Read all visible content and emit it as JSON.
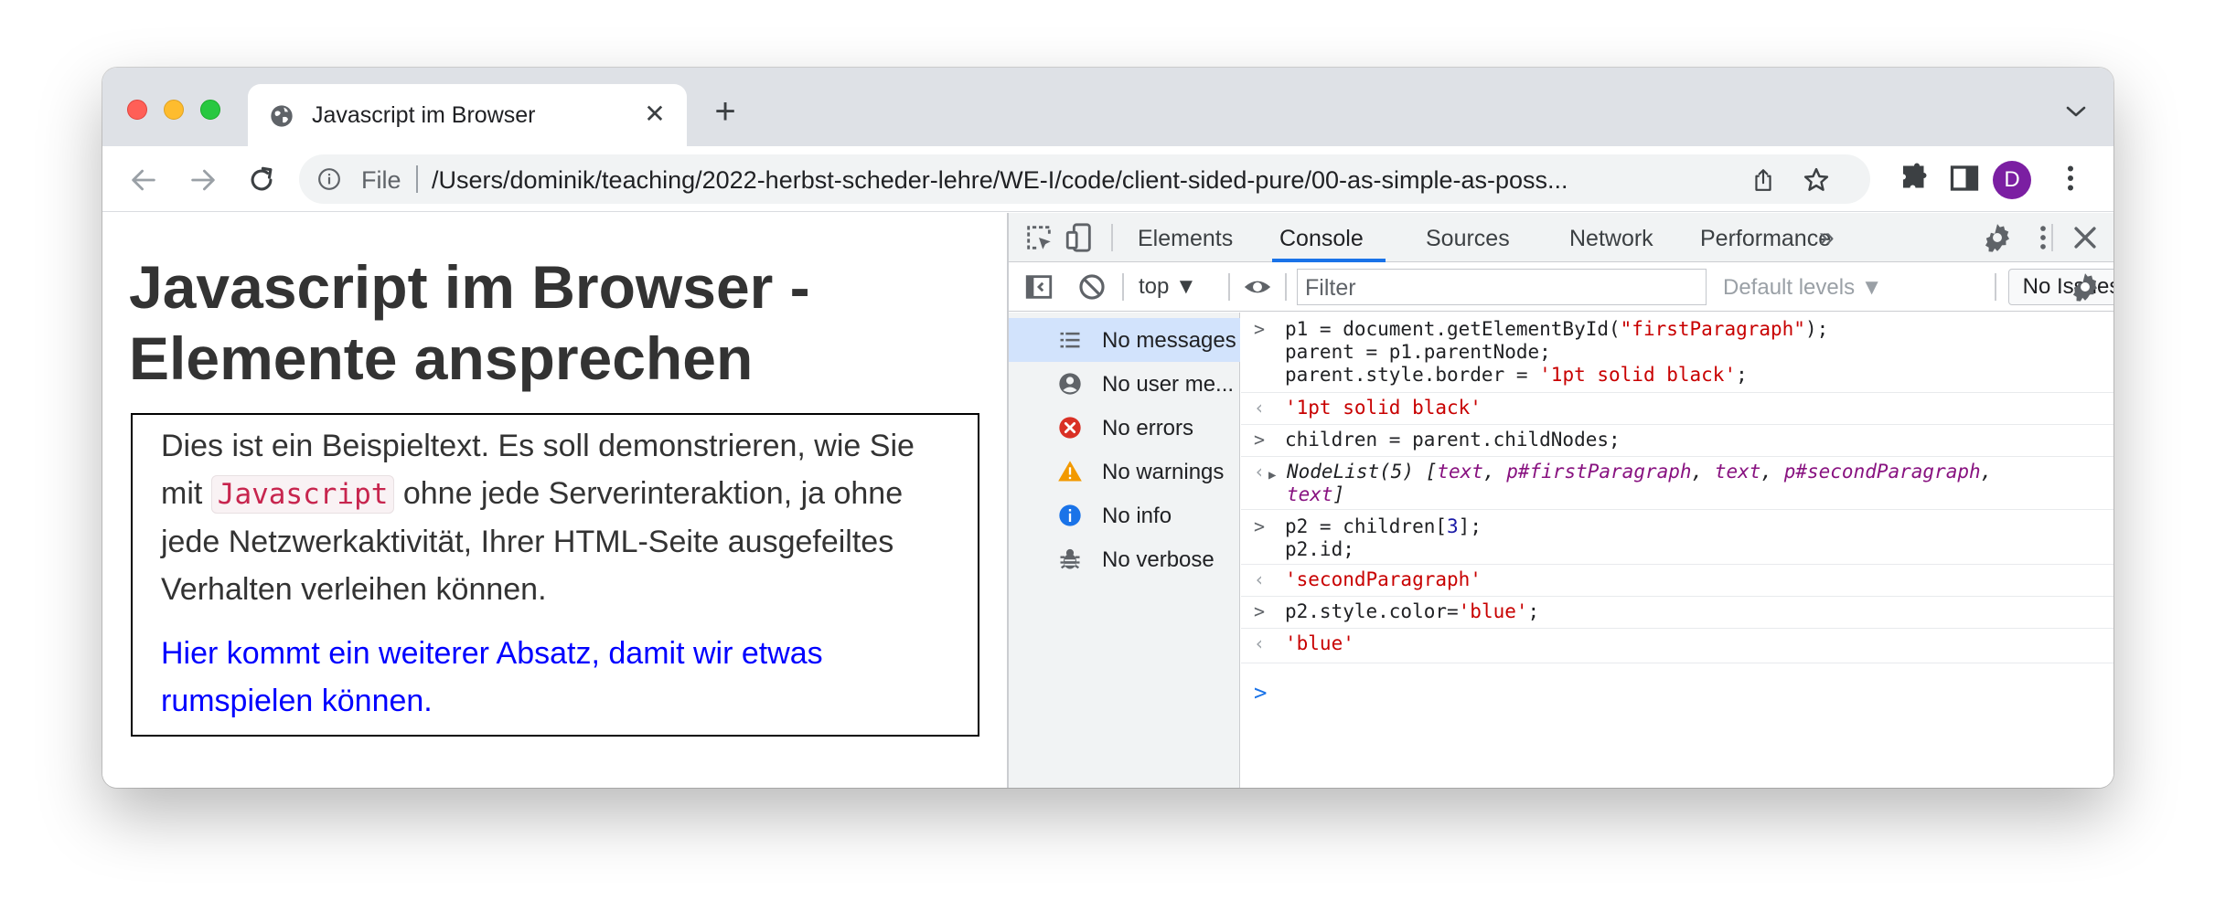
{
  "browser": {
    "tab": {
      "title": "Javascript im Browser",
      "close": "✕"
    },
    "new_tab": "+",
    "avatar_letter": "D",
    "omnibox": {
      "scheme_label": "File",
      "url": "/Users/dominik/teaching/2022-herbst-scheder-lehre/WE-I/code/client-sided-pure/00-as-simple-as-poss..."
    },
    "icons": [
      "globe-icon",
      "back-arrow-icon",
      "forward-arrow-icon",
      "reload-icon",
      "info-icon",
      "share-icon",
      "star-icon",
      "extensions-icon",
      "side-panel-icon",
      "kebab-menu-icon",
      "tab-search-icon"
    ],
    "accent_color": "#7b1fa2"
  },
  "page": {
    "title": "Javascript im Browser - Elemente ansprechen",
    "paragraph1": {
      "before": "Dies ist ein Beispieltext. Es soll demonstrieren, wie Sie mit ",
      "code": "Javascript",
      "after": " ohne jede Serverinteraktion, ja ohne jede Netzwerkaktivität, Ihrer HTML-Seite ausgefeiltes Verhalten verleihen können."
    },
    "paragraph2": "Hier kommt ein weiterer Absatz, damit wir etwas rumspielen können.",
    "paragraph2_color": "#0000ff"
  },
  "devtools": {
    "tabs": [
      "Elements",
      "Console",
      "Sources",
      "Network",
      "Performance"
    ],
    "active_tab": "Console",
    "more_tabs": "»",
    "context": "top ▼",
    "filter_placeholder": "Filter",
    "levels": "Default levels ▼",
    "issues": "No Issues",
    "sidebar": [
      {
        "label": "No messages",
        "icon": "list-icon"
      },
      {
        "label": "No user me...",
        "icon": "user-icon"
      },
      {
        "label": "No errors",
        "icon": "error-icon"
      },
      {
        "label": "No warnings",
        "icon": "warning-icon"
      },
      {
        "label": "No info",
        "icon": "info-icon"
      },
      {
        "label": "No verbose",
        "icon": "bug-icon"
      }
    ],
    "console": {
      "cmd1_lines": [
        "p1 = document.getElementById(",
        "\"firstParagraph\"",
        ");",
        "parent = p1.parentNode;",
        "parent.style.border = ",
        "'1pt solid black'",
        ";"
      ],
      "res1": "'1pt solid black'",
      "cmd2": "children = parent.childNodes;",
      "res2": [
        "NodeList(5) [",
        "text",
        ", ",
        "p#firstParagraph",
        ", ",
        "text",
        ", ",
        "p#secondParagraph",
        ",",
        "text",
        "]"
      ],
      "cmd3": [
        "p2 = children[",
        "3",
        "];",
        "p2.id;"
      ],
      "res3": "'secondParagraph'",
      "cmd4": [
        "p2.style.color=",
        "'blue'",
        ";"
      ],
      "res4": "'blue'",
      "prompt": ">",
      "result_marker": "‹",
      "expand_marker": "▶"
    }
  }
}
